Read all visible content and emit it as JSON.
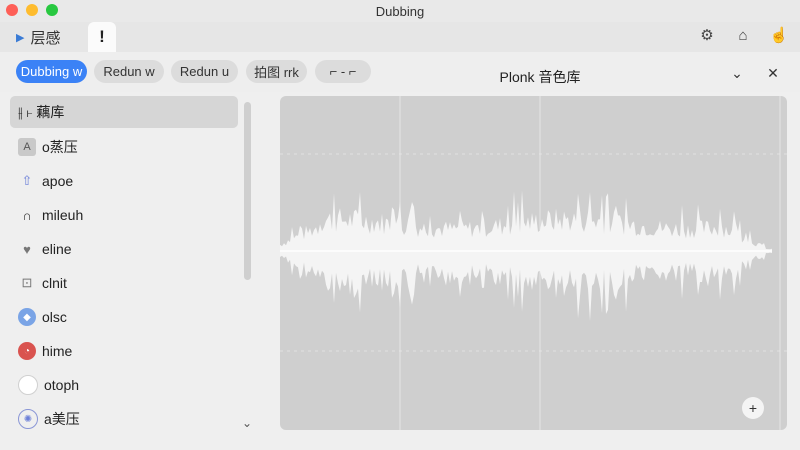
{
  "window": {
    "title": "Dubbing"
  },
  "tabs": [
    {
      "label": "层感"
    },
    {
      "label": "!"
    }
  ],
  "toolbar": {
    "chips": [
      {
        "label": "Dubbing w",
        "active": true
      },
      {
        "label": "Redun w",
        "active": false
      },
      {
        "label": "Redun u",
        "active": false
      },
      {
        "label": "拍图 rrk",
        "active": false
      },
      {
        "label": "⌐ - ⌐",
        "active": false
      }
    ]
  },
  "panel": {
    "title": "Plonk 音色库"
  },
  "sidebar": {
    "items": [
      {
        "label": "⫲ ⊦ 藕库",
        "icon": "",
        "selected": true
      },
      {
        "label": "o蒸压",
        "icon": "square-a-icon"
      },
      {
        "label": "apoe",
        "icon": "arrow-up-icon"
      },
      {
        "label": "mileuh",
        "icon": "headphones-icon"
      },
      {
        "label": "eline",
        "icon": "heart-icon"
      },
      {
        "label": "clnit",
        "icon": "contact-icon"
      },
      {
        "label": "olsc",
        "icon": "diamond-icon"
      },
      {
        "label": "hime",
        "icon": "pie-icon"
      },
      {
        "label": "otoph",
        "icon": "circle-icon"
      },
      {
        "label": "a美压",
        "icon": "ring-icon"
      }
    ]
  },
  "colors": {
    "accent": "#3b82f6",
    "waveform": "#f5f5f5",
    "panel_bg": "#cfcfcf"
  }
}
